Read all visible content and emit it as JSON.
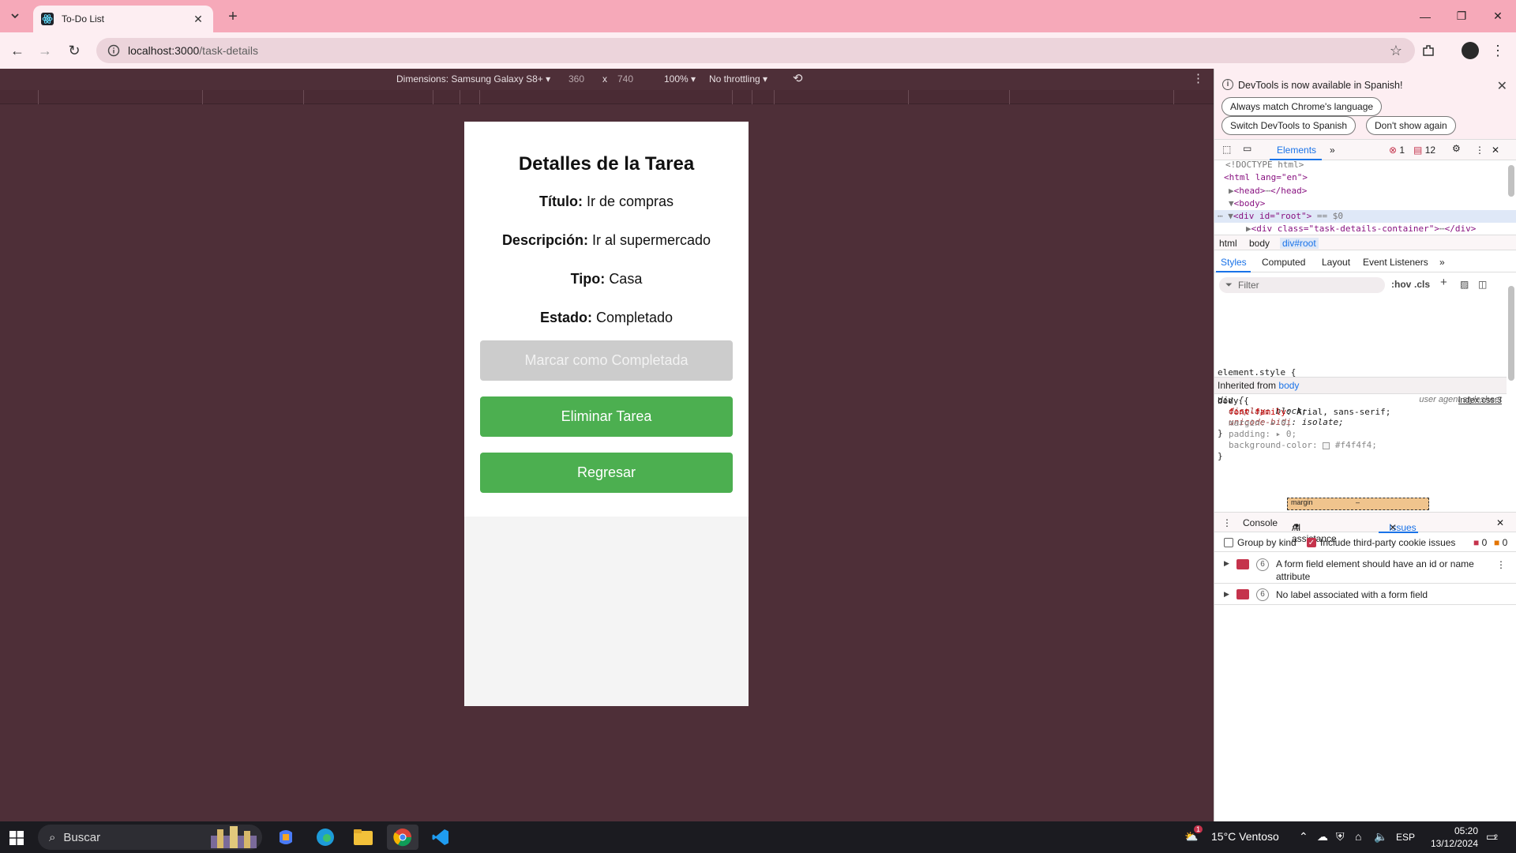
{
  "browser": {
    "tab_title": "To-Do List",
    "url_host": "localhost:3000",
    "url_path": "/task-details"
  },
  "device_toolbar": {
    "dimensions_label": "Dimensions: Samsung Galaxy S8+",
    "width": "360",
    "x": "x",
    "height": "740",
    "zoom": "100%",
    "throttling": "No throttling"
  },
  "page": {
    "title": "Detalles de la Tarea",
    "fields": [
      {
        "label": "Título:",
        "value": "Ir de compras"
      },
      {
        "label": "Descripción:",
        "value": "Ir al supermercado"
      },
      {
        "label": "Tipo:",
        "value": "Casa"
      },
      {
        "label": "Estado:",
        "value": "Completado"
      }
    ],
    "buttons": {
      "complete": "Marcar como Completada",
      "delete": "Eliminar Tarea",
      "back": "Regresar"
    },
    "colors": {
      "green": "#4caf50",
      "disabled": "#cccccc"
    }
  },
  "devtools": {
    "infobar_msg": "DevTools is now available in Spanish!",
    "btn_match": "Always match Chrome's language",
    "btn_switch": "Switch DevTools to Spanish",
    "btn_dont": "Don't show again",
    "tab_elements": "Elements",
    "error_count": "1",
    "message_count": "12",
    "dom": {
      "doctype": "<!DOCTYPE html>",
      "html_open": "<html lang=\"en\">",
      "head": "<head>",
      "head_close": "</head>",
      "body": "<body>",
      "root_div": "<div id=\"root\">",
      "root_marker": "== $0",
      "child_div": "<div class=\"task-details-container\">",
      "child_close": "</div>"
    },
    "crumbs": [
      "html",
      "body",
      "div#root"
    ],
    "sub_tabs": [
      "Styles",
      "Computed",
      "Layout",
      "Event Listeners"
    ],
    "filter_placeholder": "Filter",
    "hov": ":hov",
    "cls": ".cls",
    "styles": {
      "element_style": "element.style {",
      "close": "}",
      "div_selector": "div {",
      "ua_label": "user agent stylesheet",
      "display_prop": "display",
      "display_val": "block;",
      "unicode_prop": "unicode-bidi",
      "unicode_val": "isolate;",
      "inherited_label": "Inherited from",
      "inherited_from": "body",
      "body_selector": "body {",
      "src_link": "index.css:3",
      "ff_prop": "font-family",
      "ff_val": "Arial, sans-serif;",
      "margin_prop": "margin",
      "margin_val": "0;",
      "padding_prop": "padding",
      "padding_val": "0;",
      "bg_prop": "background-color",
      "bg_val": "#f4f4f4;",
      "box_margin": "margin",
      "box_dash": "–"
    },
    "drawer_tabs": [
      "Console",
      "AI assistance",
      "Issues"
    ],
    "group_by_kind": "Group by kind",
    "include_third": "Include third-party cookie issues",
    "issue_counts": [
      "0",
      "0"
    ],
    "issues": [
      {
        "count": "6",
        "text": "A form field element should have an id or name attribute"
      },
      {
        "count": "6",
        "text": "No label associated with a form field"
      }
    ]
  },
  "taskbar": {
    "search_placeholder": "Buscar",
    "weather": "15°C  Ventoso",
    "weather_badge": "1",
    "lang": "ESP",
    "time": "05:20",
    "date": "13/12/2024",
    "notif_count": "2"
  }
}
